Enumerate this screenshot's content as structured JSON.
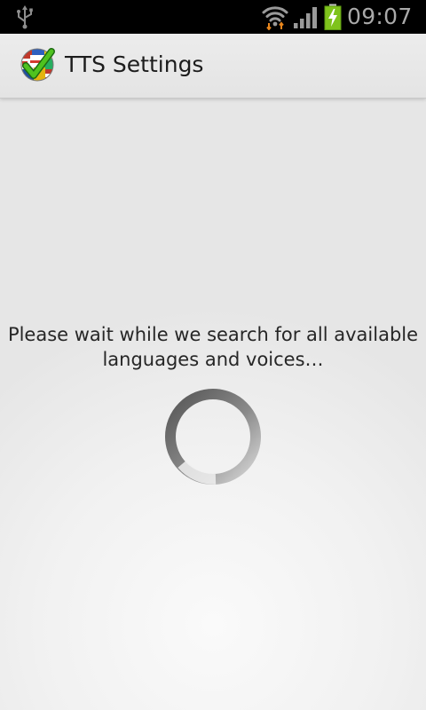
{
  "status_bar": {
    "time": "09:07",
    "icons": [
      "usb-icon",
      "wifi-icon",
      "signal-icon",
      "battery-charging-icon"
    ]
  },
  "action_bar": {
    "title": "TTS Settings",
    "icon": "app-globe-check-icon"
  },
  "content": {
    "message_line1": "Please wait while we search for all available",
    "message_line2": "languages and voices…",
    "spinner": "loading-spinner"
  },
  "colors": {
    "status_bar_bg": "#000000",
    "clock_text": "#a9a9a9",
    "battery_green": "#7fc31c",
    "action_bar_bg": "#e8e8e8",
    "background": "#ececec"
  }
}
